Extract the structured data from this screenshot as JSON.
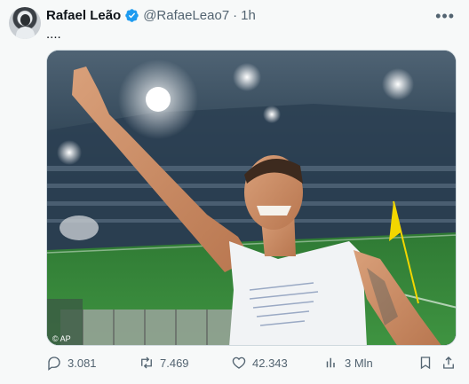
{
  "tweet": {
    "author_name": "Rafael Leão",
    "handle": "@RafaeLeao7",
    "separator": "·",
    "time": "1h",
    "text": "....",
    "media_credit": "© AP"
  },
  "actions": {
    "replies": "3.081",
    "reposts": "7.469",
    "likes": "42.343",
    "views": "3 Mln"
  },
  "shirt_text": "...la canzone... quei modi ...",
  "colors": {
    "verified": "#1d9bf0",
    "muted_text": "#536471",
    "pitch": "#2f7a34",
    "corner_flag": "#f2d600"
  }
}
